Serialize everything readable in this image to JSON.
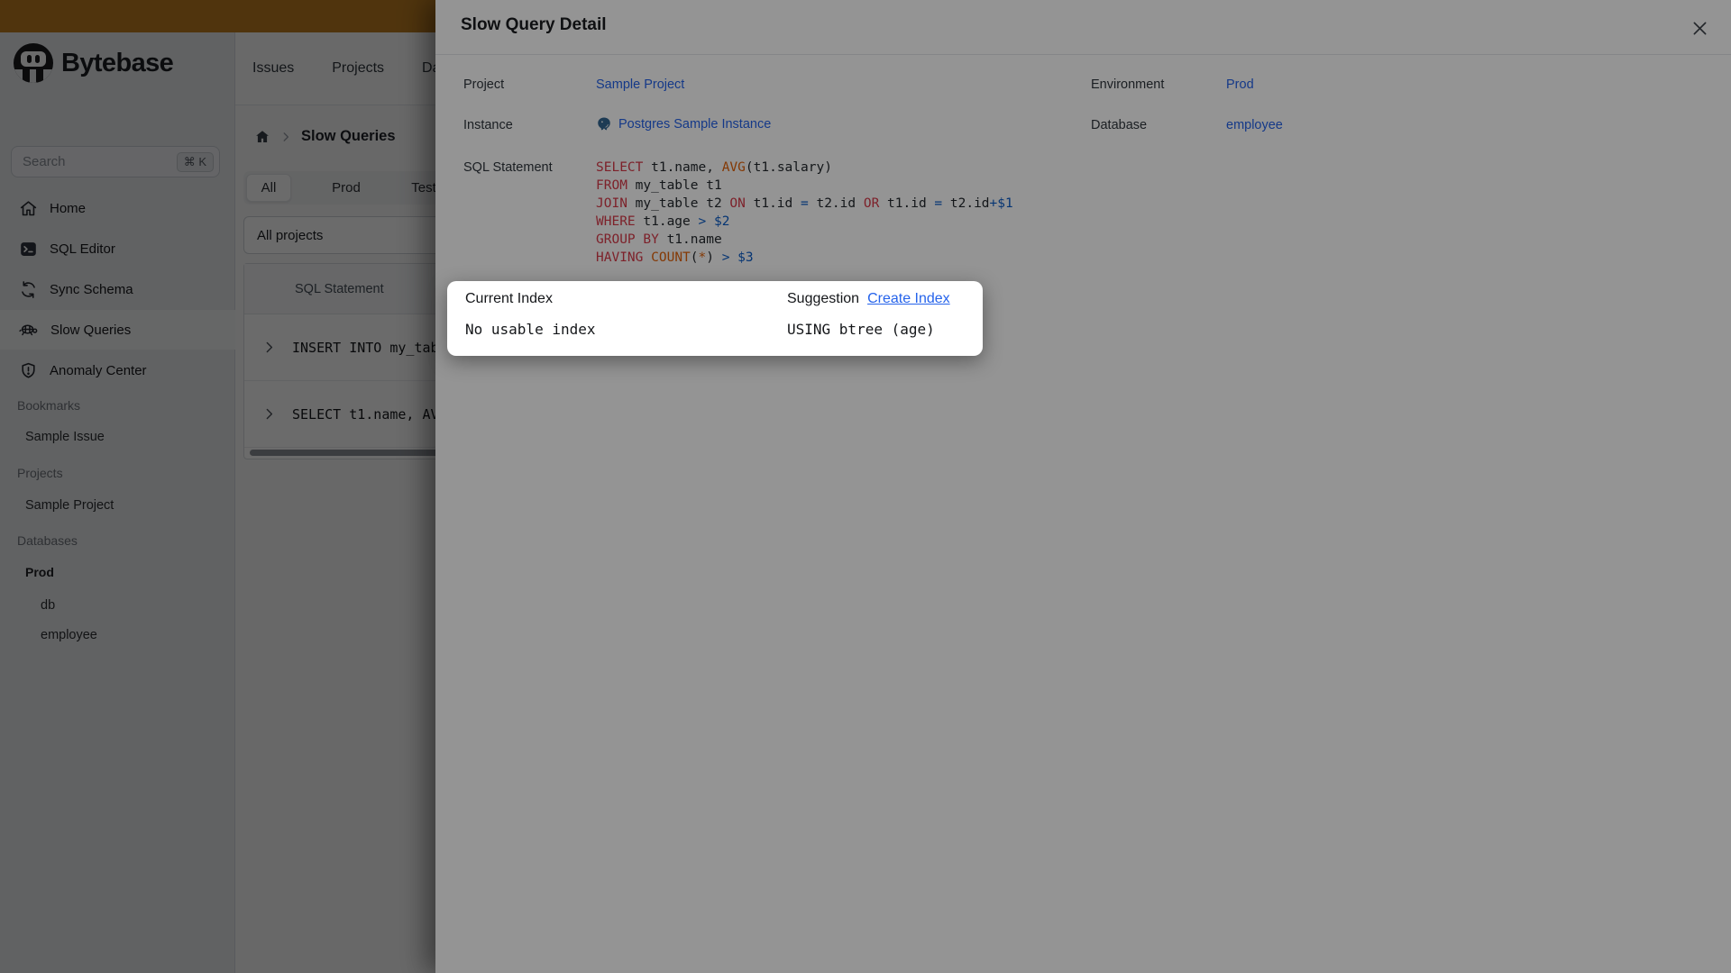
{
  "colors": {
    "banner": "#c07e22",
    "accent": "#2563eb",
    "keyword": "#d73a49",
    "builtin": "#e36209",
    "literal": "#0b5cc7",
    "code": "#24292e"
  },
  "brand": {
    "name": "Bytebase"
  },
  "topnav": {
    "items": [
      "Issues",
      "Projects",
      "Databases"
    ]
  },
  "sidebar": {
    "search": {
      "placeholder": "Search",
      "shortcut": "⌘ K"
    },
    "nav": [
      {
        "icon": "home-icon",
        "label": "Home"
      },
      {
        "icon": "terminal-icon",
        "label": "SQL Editor"
      },
      {
        "icon": "sync-icon",
        "label": "Sync Schema"
      },
      {
        "icon": "turtle-icon",
        "label": "Slow Queries",
        "active": true
      },
      {
        "icon": "shield-icon",
        "label": "Anomaly Center"
      }
    ],
    "sections": {
      "bookmarks": {
        "title": "Bookmarks",
        "item": "Sample Issue"
      },
      "projects": {
        "title": "Projects",
        "item": "Sample Project"
      },
      "databases": {
        "title": "Databases",
        "env": "Prod",
        "dbs": [
          "db",
          "employee"
        ]
      }
    }
  },
  "content": {
    "breadcrumb": "Slow Queries",
    "tabs": [
      "All",
      "Prod",
      "Test"
    ],
    "active_tab": "All",
    "project_filter": "All projects",
    "table": {
      "header": "SQL Statement",
      "rows": [
        "INSERT INTO my_tab",
        "SELECT t1.name, AV"
      ]
    }
  },
  "modal": {
    "title": "Slow Query Detail",
    "fields": [
      {
        "label": "Project",
        "value": "Sample Project"
      },
      {
        "label": "Environment",
        "value": "Prod"
      },
      {
        "label": "Instance",
        "value": "Postgres Sample Instance"
      },
      {
        "label": "Database",
        "value": "employee"
      }
    ],
    "sql_label": "SQL Statement",
    "sql_text": "SELECT t1.name, AVG(t1.salary)\nFROM my_table t1\nJOIN my_table t2 ON t1.id = t2.id OR t1.id = t2.id+$1\nWHERE t1.age > $2\nGROUP BY t1.name\nHAVING COUNT(*) > $3",
    "sql_lines": [
      [
        [
          "k",
          "SELECT"
        ],
        [
          "d",
          " t1.name, "
        ],
        [
          "f",
          "AVG"
        ],
        [
          "d",
          "(t1.salary)"
        ]
      ],
      [
        [
          "k",
          "FROM"
        ],
        [
          "d",
          " my_table t1"
        ]
      ],
      [
        [
          "k",
          "JOIN"
        ],
        [
          "d",
          " my_table t2 "
        ],
        [
          "k",
          "ON"
        ],
        [
          "d",
          " t1.id "
        ],
        [
          "o",
          "="
        ],
        [
          "d",
          " t2.id "
        ],
        [
          "k",
          "OR"
        ],
        [
          "d",
          " t1.id "
        ],
        [
          "o",
          "="
        ],
        [
          "d",
          " t2.id"
        ],
        [
          "o",
          "+"
        ],
        [
          "n",
          "$1"
        ]
      ],
      [
        [
          "k",
          "WHERE"
        ],
        [
          "d",
          " t1.age "
        ],
        [
          "o",
          ">"
        ],
        [
          "n",
          " $2"
        ]
      ],
      [
        [
          "k",
          "GROUP BY"
        ],
        [
          "d",
          " t1.name"
        ]
      ],
      [
        [
          "k",
          "HAVING"
        ],
        [
          "d",
          " "
        ],
        [
          "f",
          "COUNT"
        ],
        [
          "d",
          "("
        ],
        [
          "s",
          "*"
        ],
        [
          "d",
          ") "
        ],
        [
          "o",
          ">"
        ],
        [
          "n",
          " $3"
        ]
      ]
    ]
  },
  "popup": {
    "current_index_label": "Current Index",
    "current_index_value": "No usable index",
    "suggestion_label": "Suggestion",
    "suggestion_link": "Create Index",
    "suggestion_value": "USING btree (age)"
  }
}
